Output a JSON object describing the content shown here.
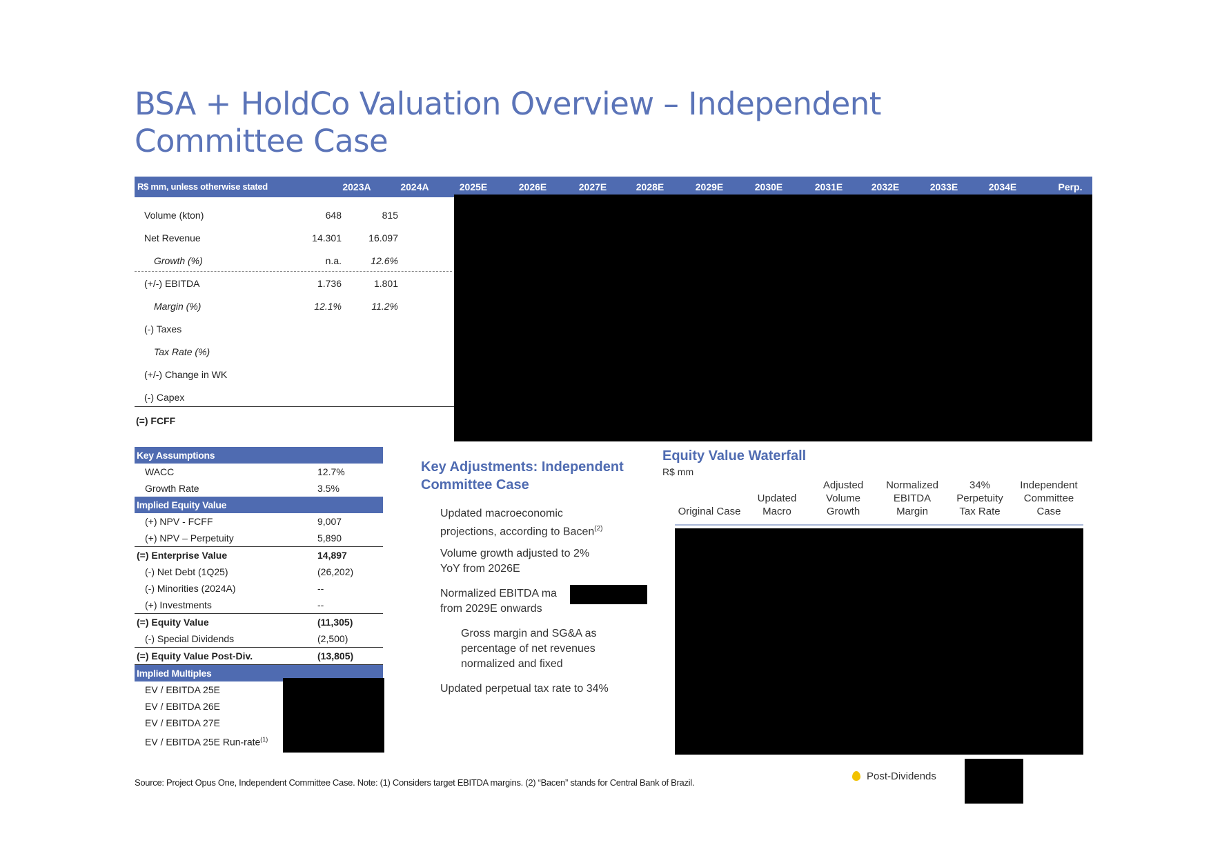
{
  "title": "BSA + HoldCo Valuation Overview – Independent Committee Case",
  "table": {
    "header_label": "R$ mm, unless otherwise stated",
    "years": [
      "2023A",
      "2024A",
      "2025E",
      "2026E",
      "2027E",
      "2028E",
      "2029E",
      "2030E",
      "2031E",
      "2032E",
      "2033E",
      "2034E",
      "Perp."
    ],
    "rows": [
      {
        "label": "Volume (kton)",
        "v1": "648",
        "v2": "815"
      },
      {
        "label": "Net Revenue",
        "v1": "14.301",
        "v2": "16.097"
      },
      {
        "label": "Growth (%)",
        "v1": "n.a.",
        "v2": "12.6%"
      },
      {
        "label": "(+/-) EBITDA",
        "v1": "1.736",
        "v2": "1.801"
      },
      {
        "label": "Margin (%)",
        "v1": "12.1%",
        "v2": "11.2%"
      },
      {
        "label": "(-) Taxes",
        "v1": "",
        "v2": ""
      },
      {
        "label": "Tax Rate (%)",
        "v1": "",
        "v2": ""
      },
      {
        "label": "(+/-) Change in WK",
        "v1": "",
        "v2": ""
      },
      {
        "label": "(-) Capex",
        "v1": "",
        "v2": ""
      },
      {
        "label": "(=) FCFF",
        "v1": "",
        "v2": ""
      }
    ]
  },
  "assumptions": {
    "key_header": "Key Assumptions",
    "wacc_label": "WACC",
    "wacc": "12.7%",
    "growth_label": "Growth Rate",
    "growth": "3.5%",
    "implied_header": "Implied Equity Value",
    "npv_fcff_label": "(+) NPV - FCFF",
    "npv_fcff": "9,007",
    "npv_perp_label": "(+) NPV – Perpetuity",
    "npv_perp": "5,890",
    "ev_label": "(=) Enterprise Value",
    "ev": "14,897",
    "net_debt_label": "(-) Net Debt (1Q25)",
    "net_debt": "(26,202)",
    "minorities_label": "(-) Minorities (2024A)",
    "minorities": "--",
    "investments_label": "(+) Investments",
    "investments": "--",
    "equity_label": "(=) Equity Value",
    "equity": "(11,305)",
    "special_div_label": "(-) Special Dividends",
    "special_div": "(2,500)",
    "equity_post_label": "(=) Equity Value Post-Div.",
    "equity_post": "(13,805)",
    "multiples_header": "Implied Multiples",
    "mult1": "EV / EBITDA 25E",
    "mult2": "EV / EBITDA 26E",
    "mult3": "EV / EBITDA 27E",
    "mult4": "EV / EBITDA 25E Run-rate",
    "mult4_sup": "(1)"
  },
  "adjustments": {
    "heading_line1": "Key Adjustments: Independent",
    "heading_line2": "Committee Case",
    "item1_line1": "Updated macroeconomic",
    "item1_line2": "projections, according to Bacen",
    "item1_sup": "(2)",
    "item2_line1": "Volume growth adjusted to 2%",
    "item2_line2": "YoY from 2026E",
    "item3_line1": "Normalized EBITDA ma",
    "item3_line2": "from 2029E onwards",
    "item4_line1": "Gross margin and SG&A as",
    "item4_line2": "percentage of net revenues",
    "item4_line3": "normalized and fixed",
    "item5": "Updated perpetual tax rate to 34%"
  },
  "waterfall": {
    "title": "Equity Value Waterfall",
    "unit": "R$ mm",
    "col1": "Original Case",
    "col2_l1": "Updated",
    "col2_l2": "Macro",
    "col3_l1": "Adjusted",
    "col3_l2": "Volume",
    "col3_l3": "Growth",
    "col4_l1": "Normalized",
    "col4_l2": "EBITDA",
    "col4_l3": "Margin",
    "col5_l1": "34%",
    "col5_l2": "Perpetuity",
    "col5_l3": "Tax Rate",
    "col6_l1": "Independent",
    "col6_l2": "Committee",
    "col6_l3": "Case"
  },
  "footer": {
    "source": "Source: Project Opus One, Independent Committee Case. Note: (1) Considers target EBITDA margins. (2) “Bacen” stands for Central Bank of Brazil.",
    "legend": "Post-Dividends"
  },
  "colors": {
    "brand_blue": "#4f6bb1",
    "title_blue": "#5b74b8",
    "legend_dot": "#f2c200"
  }
}
